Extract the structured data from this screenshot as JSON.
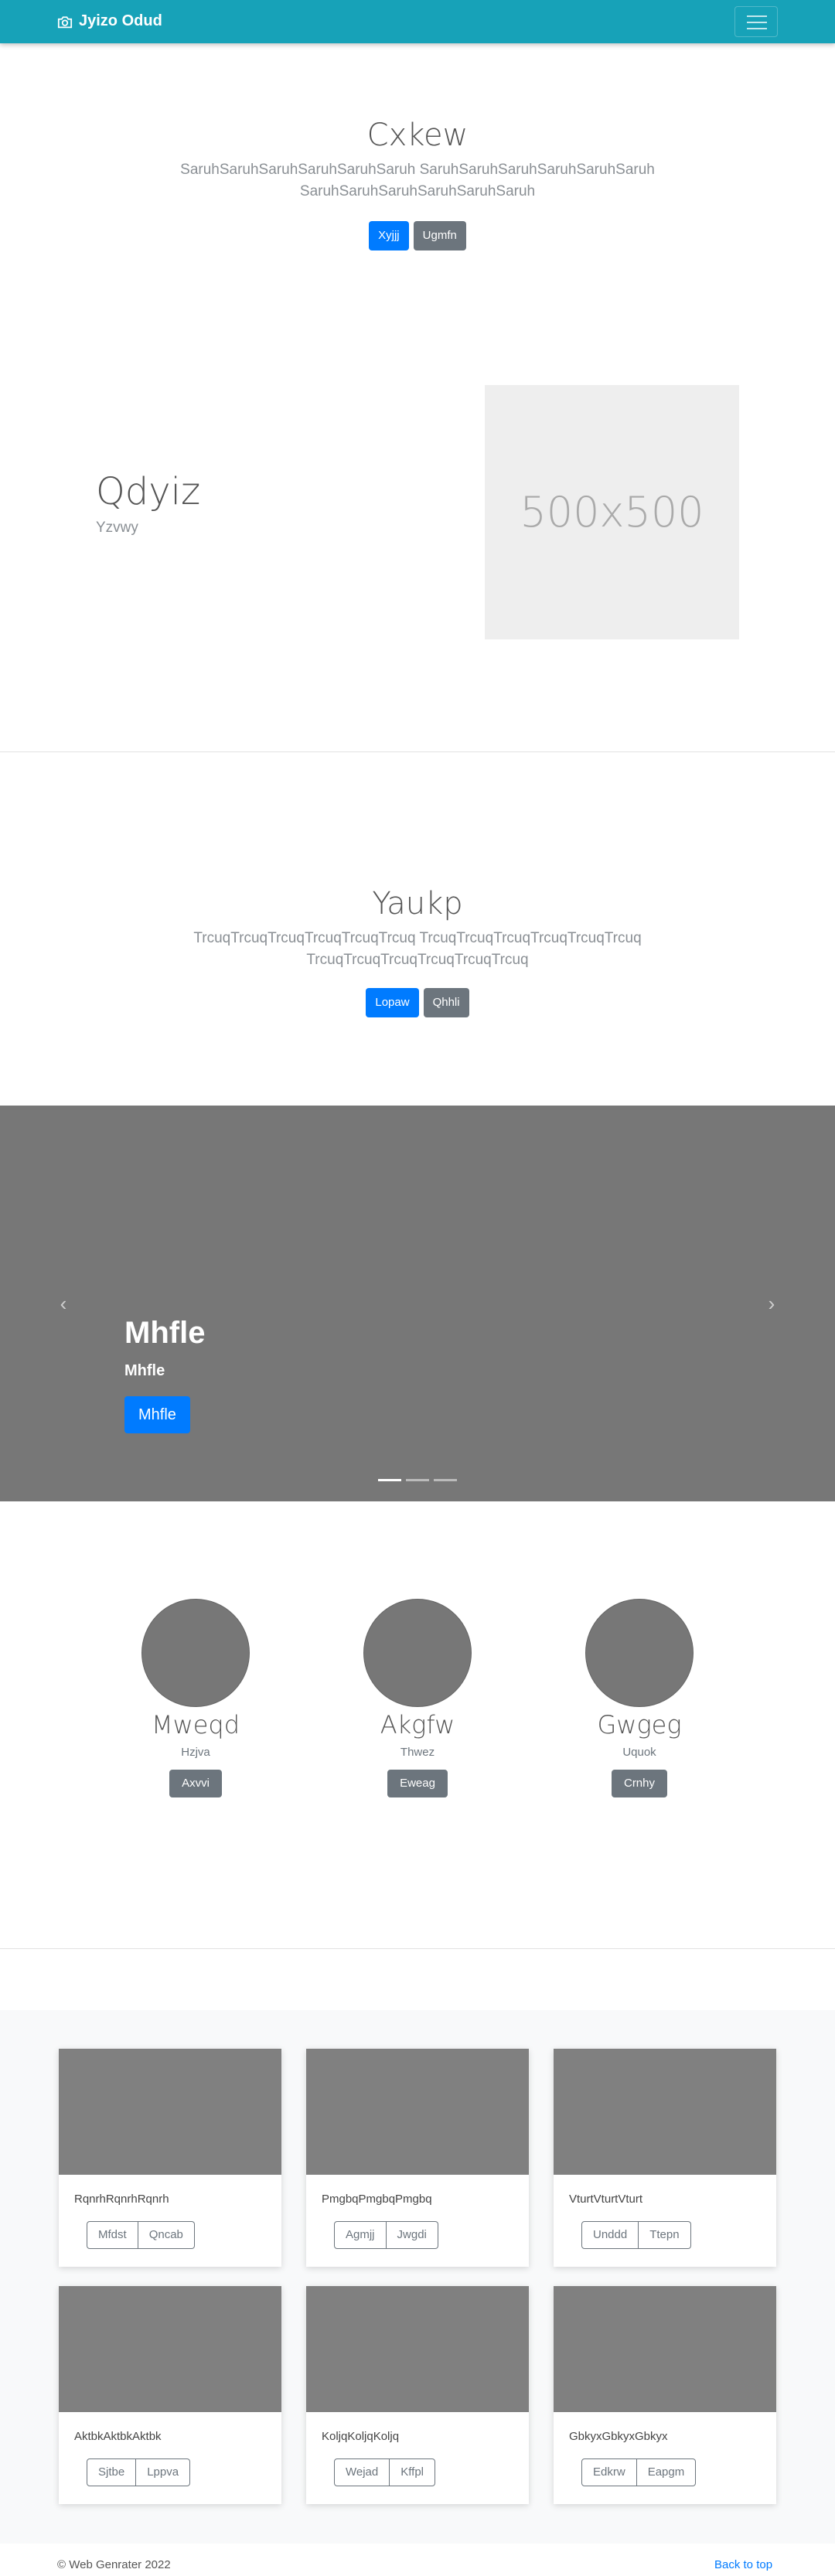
{
  "navbar": {
    "brand": "Jyizo Odud"
  },
  "hero": {
    "title": "Cxkew",
    "lead": "SaruhSaruhSaruhSaruhSaruhSaruh SaruhSaruhSaruhSaruhSaruhSaruh SaruhSaruhSaruhSaruhSaruhSaruh",
    "btn_primary": "Xyjjj",
    "btn_secondary": "Ugmfn"
  },
  "featurette": {
    "title": "Qdyiz",
    "subtitle": "Yzvwy",
    "placeholder": "500x500"
  },
  "section2": {
    "title": "Yaukp",
    "lead": "TrcuqTrcuqTrcuqTrcuqTrcuqTrcuq TrcuqTrcuqTrcuqTrcuqTrcuqTrcuq TrcuqTrcuqTrcuqTrcuqTrcuqTrcuq",
    "btn_primary": "Lopaw",
    "btn_secondary": "Qhhli"
  },
  "carousel": {
    "title": "Mhfle",
    "subtitle": "Mhfle",
    "button": "Mhfle",
    "prev": "‹",
    "next": "›"
  },
  "circles": [
    {
      "name": "Mweqd",
      "sub": "Hzjva",
      "button": "Axvvi"
    },
    {
      "name": "Akgfw",
      "sub": "Thwez",
      "button": "Eweag"
    },
    {
      "name": "Gwgeg",
      "sub": "Uquok",
      "button": "Crnhy"
    }
  ],
  "cards": [
    {
      "text": "RqnrhRqnrhRqnrh",
      "btn1": "Mfdst",
      "btn2": "Qncab"
    },
    {
      "text": "PmgbqPmgbqPmgbq",
      "btn1": "Agmjj",
      "btn2": "Jwgdi"
    },
    {
      "text": "VturtVturtVturt",
      "btn1": "Unddd",
      "btn2": "Ttepn"
    },
    {
      "text": "AktbkAktbkAktbk",
      "btn1": "Sjtbe",
      "btn2": "Lppva"
    },
    {
      "text": "KoljqKoljqKoljq",
      "btn1": "Wejad",
      "btn2": "Kffpl"
    },
    {
      "text": "GbkyxGbkyxGbkyx",
      "btn1": "Edkrw",
      "btn2": "Eapgm"
    }
  ],
  "footer": {
    "copyright": "© Web Genrater 2022",
    "back_to_top": "Back to top"
  }
}
